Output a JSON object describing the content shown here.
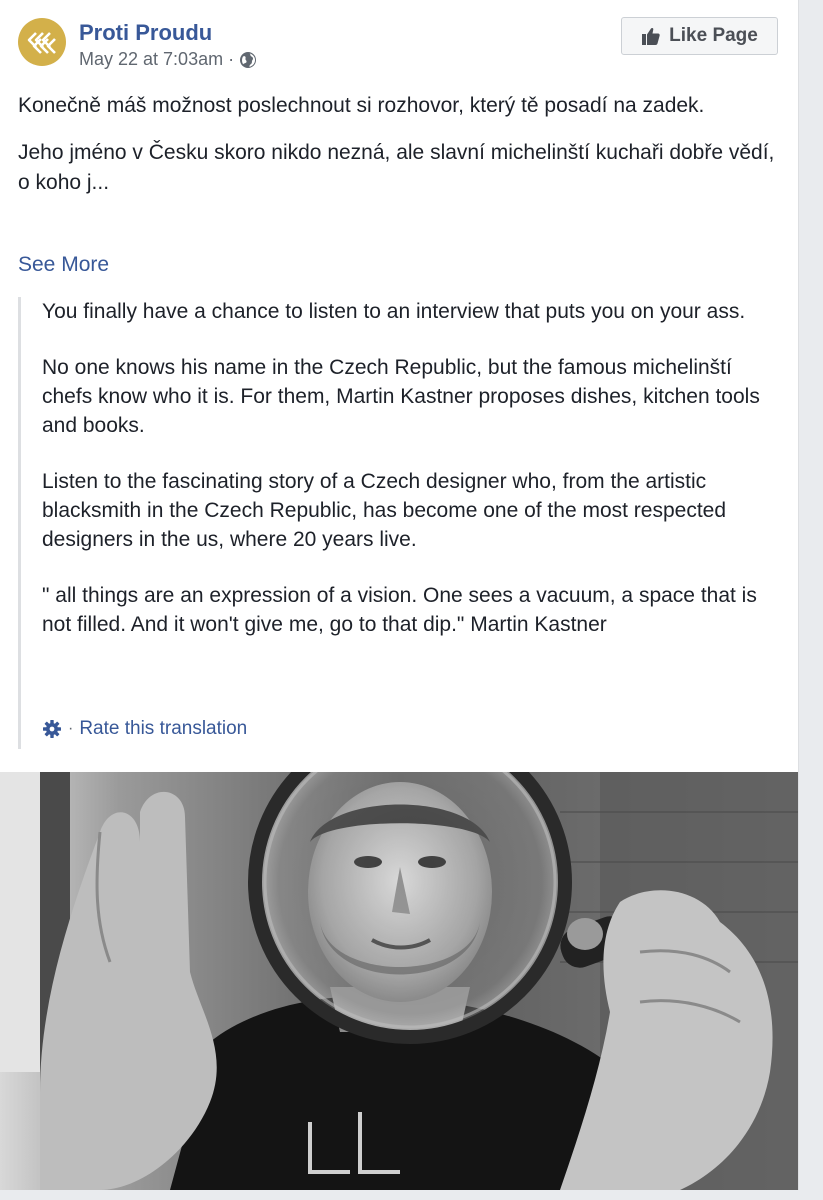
{
  "post": {
    "page_name": "Proti Proudu",
    "timestamp": "May 22 at 7:03am",
    "meta_separator": "·",
    "like_button_label": "Like Page",
    "text": [
      "Konečně máš možnost poslechnout si rozhovor, který tě posadí na zadek.",
      "Jeho jméno v Česku skoro nikdo nezná, ale slavní michelinští kuchaři dobře vědí, o koho j..."
    ],
    "see_more_label": "See More",
    "translation": {
      "paragraphs": [
        "You finally have a chance to listen to an interview that puts you on your ass.",
        "No one knows his name in the Czech Republic, but the famous michelinští chefs know who it is. For them, Martin Kastner proposes dishes, kitchen tools and books.",
        "Listen to the fascinating story of a Czech designer who, from the artistic blacksmith in the Czech Republic, has become one of the most respected designers in the us, where 20 years live.",
        "\" all things are an expression of a vision. One sees a vacuum, a space that is not filled. And it won't give me, go to that dip.\" Martin Kastner"
      ],
      "rate_separator": "·",
      "rate_label": "Rate this translation"
    },
    "icons": {
      "avatar": "chevrons-logo-icon",
      "privacy": "globe-icon",
      "like": "thumbs-up-icon",
      "settings": "gear-icon"
    },
    "colors": {
      "link": "#385898",
      "avatar_bg": "#d3b04a",
      "meta": "#606770"
    }
  }
}
